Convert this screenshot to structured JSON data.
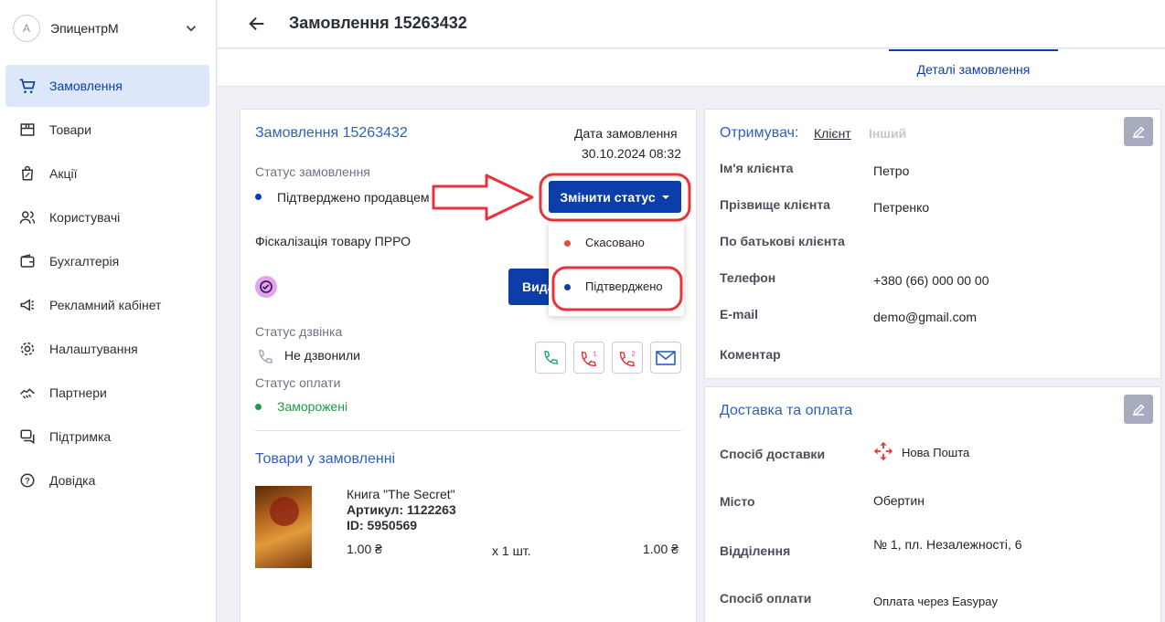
{
  "account": {
    "avatar_letter": "A",
    "name": "ЭпицентрМ"
  },
  "sidebar": {
    "items": [
      {
        "label": "Замовлення",
        "icon": "cart-icon",
        "active": true
      },
      {
        "label": "Товари",
        "icon": "box-icon"
      },
      {
        "label": "Акції",
        "icon": "discount-bag-icon"
      },
      {
        "label": "Користувачі",
        "icon": "users-icon"
      },
      {
        "label": "Бухгалтерія",
        "icon": "wallet-icon"
      },
      {
        "label": "Рекламний кабінет",
        "icon": "megaphone-icon"
      },
      {
        "label": "Налаштування",
        "icon": "gear-icon"
      },
      {
        "label": "Партнери",
        "icon": "handshake-icon"
      },
      {
        "label": "Підтримка",
        "icon": "chat-icon"
      },
      {
        "label": "Довідка",
        "icon": "help-icon"
      }
    ]
  },
  "header": {
    "title": "Замовлення 15263432"
  },
  "tabs": {
    "details": "Деталі замовлення"
  },
  "order": {
    "title": "Замовлення 15263432",
    "date_label": "Дата замовлення",
    "date": "30.10.2024 08:32",
    "status_label": "Статус замовлення",
    "status": "Підтверджено продавцем",
    "change_status_btn": "Змінити статус",
    "fiscal_label": "Фіскалізація товару ПРРО",
    "partial_btn": "Вида",
    "call_status_label": "Статус дзвінка",
    "call_status": "Не дзвонили",
    "payment_status_label": "Статус оплати",
    "payment_status": "Заморожені"
  },
  "dropdown": {
    "items": [
      "Скасовано",
      "Підтверджено"
    ]
  },
  "products": {
    "heading": "Товари у замовленні",
    "items": [
      {
        "name": "Книга \"The Secret\"",
        "article": "Артикул: 1122263",
        "id": "ID: 5950569",
        "price": "1.00 ₴",
        "qty": "x 1 шт.",
        "total": "1.00 ₴"
      }
    ]
  },
  "recipient": {
    "heading": "Отримувач:",
    "tab_client": "Клієнт",
    "tab_other": "Інший",
    "fields": [
      {
        "label": "Ім'я клієнта",
        "value": "Петро"
      },
      {
        "label": "Прізвище клієнта",
        "value": "Петренко"
      },
      {
        "label": "По батькові клієнта",
        "value": ""
      },
      {
        "label": "Телефон",
        "value": "+380 (66) 000 00 00"
      },
      {
        "label": "E-mail",
        "value": "demo@gmail.com"
      },
      {
        "label": "Коментар",
        "value": ""
      }
    ]
  },
  "delivery": {
    "heading": "Доставка та оплата",
    "fields": [
      {
        "label": "Спосіб доставки",
        "value": "Нова Пошта"
      },
      {
        "label": "Місто",
        "value": "Обертин"
      },
      {
        "label": "Відділення",
        "value": "№ 1, пл. Незалежності, 6"
      },
      {
        "label": "Спосіб оплати",
        "value": "Оплата через Easypay"
      }
    ]
  },
  "colors": {
    "brand_blue": "#0c3da8",
    "accent_red": "#e8323c",
    "success_green": "#1f9a47",
    "cancel_red": "#e74c3c"
  }
}
